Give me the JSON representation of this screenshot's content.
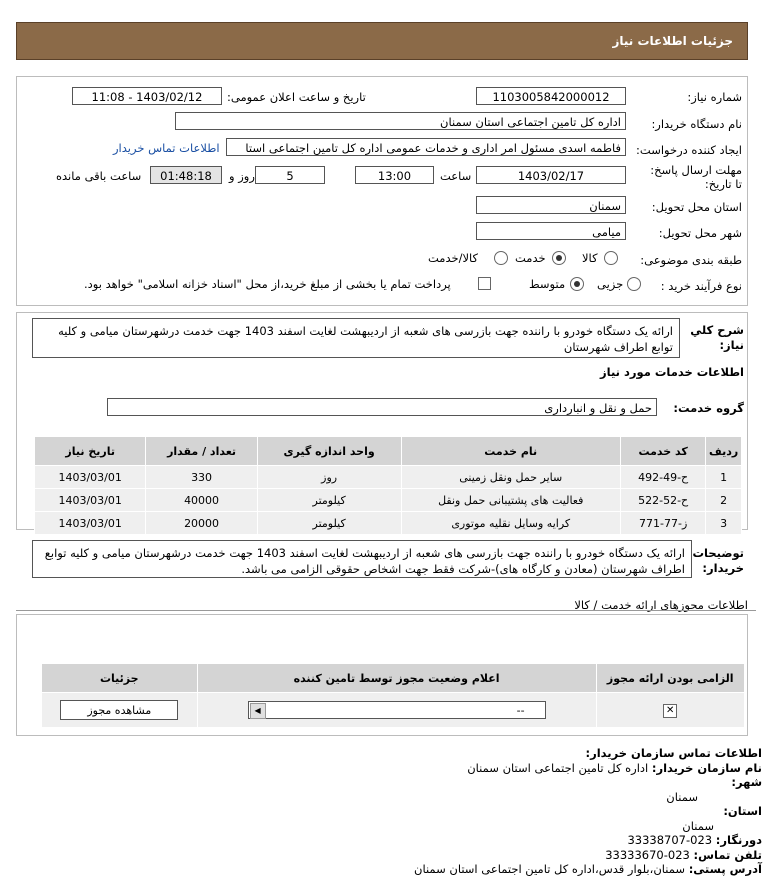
{
  "header": {
    "title": "جزئیات اطلاعات نیاز"
  },
  "form": {
    "need_number_label": "شماره نیاز:",
    "need_number": "1103005842000012",
    "announce_label": "تاریخ و ساعت اعلان عمومی:",
    "announce_value": "1403/02/12 - 11:08",
    "buyer_org_label": "نام دستگاه خریدار:",
    "buyer_org": "اداره کل تامین اجتماعی استان سمنان",
    "creator_label": "ایجاد کننده درخواست:",
    "creator": "فاطمه اسدی مسئول امر اداری و خدمات عمومی اداره کل تامین اجتماعی استا",
    "buyer_contact_link": "اطلاعات تماس خریدار",
    "deadline_label": "مهلت ارسال پاسخ: تا تاریخ:",
    "deadline_date": "1403/02/17",
    "time_label": "ساعت",
    "deadline_time": "13:00",
    "days_value": "5",
    "days_label": "روز و",
    "remaining_time": "01:48:18",
    "remaining_label": "ساعت باقی مانده",
    "province_label": "استان محل تحویل:",
    "province": "سمنان",
    "city_label": "شهر محل تحویل:",
    "city": "میامی",
    "category_label": "طبقه بندی موضوعی:",
    "category_options": [
      "کالا",
      "خدمت",
      "کالا/خدمت"
    ],
    "category_selected": "خدمت",
    "process_label": "نوع فرآیند خرید :",
    "process_options": [
      "جزیی",
      "متوسط"
    ],
    "process_selected": "متوسط",
    "payment_note": "پرداخت تمام یا بخشی از مبلغ خرید،از محل \"اسناد خزانه اسلامی\" خواهد بود."
  },
  "description": {
    "label": "شرح کلي نياز:",
    "text": "ارائه یک دستگاه خودرو با راننده جهت بازرسی های شعبه از اردیبهشت لغایت اسفند 1403 جهت خدمت درشهرستان میامی و کلیه توابع اطراف شهرستان"
  },
  "services": {
    "section_title": "اطلاعات خدمات مورد نیاز",
    "group_label": "گروه خدمت:",
    "group_value": "حمل و نقل و انبارداری",
    "columns": [
      "ردیف",
      "کد خدمت",
      "نام خدمت",
      "واحد اندازه گیری",
      "تعداد / مقدار",
      "تاریخ نیاز"
    ],
    "rows": [
      {
        "idx": "1",
        "code": "ح-49-492",
        "name": "سایر حمل ونقل زمینی",
        "unit": "روز",
        "qty": "330",
        "date": "1403/03/01"
      },
      {
        "idx": "2",
        "code": "ح-52-522",
        "name": "فعالیت های پشتیبانی حمل ونقل",
        "unit": "کیلومتر",
        "qty": "40000",
        "date": "1403/03/01"
      },
      {
        "idx": "3",
        "code": "ز-77-771",
        "name": "کرایه وسایل نقلیه موتوری",
        "unit": "کیلومتر",
        "qty": "20000",
        "date": "1403/03/01"
      }
    ]
  },
  "buyer_notes": {
    "label": "توضیحات خریدار:",
    "text": "ارائه یک دستگاه خودرو با راننده جهت بازرسی های شعبه از اردیبهشت لغایت اسفند 1403 جهت خدمت درشهرستان میامی و کلیه توابع اطراف شهرستان (معادن و کارگاه های)-شرکت فقط جهت اشخاص حقوقی الزامی می باشد."
  },
  "permits": {
    "section_title": "اطلاعات مجوزهای ارائه خدمت / کالا",
    "columns": [
      "الزامی بودن ارائه مجوز",
      "اعلام وضعیت مجوز توسط تامین کننده",
      "جزئیات"
    ],
    "select_value": "--",
    "view_button": "مشاهده مجوز"
  },
  "contact": {
    "title": "اطلاعات تماس سازمان خریدار:",
    "org_label": "نام سازمان خریدار:",
    "org_value": "اداره کل تامین اجتماعی استان سمنان",
    "city_label": "شهر:",
    "city_value": "سمنان",
    "province_label": "استان:",
    "province_value": "سمنان",
    "fax_label": "دورنگار:",
    "fax_value": "023-33338707",
    "phone_label": "تلفن تماس:",
    "phone_value": "023-33333670",
    "address_label": "آدرس پستی:",
    "address_value": "سمنان،بلوار قدس،اداره کل تامین اجتماعی استان سمنان"
  }
}
